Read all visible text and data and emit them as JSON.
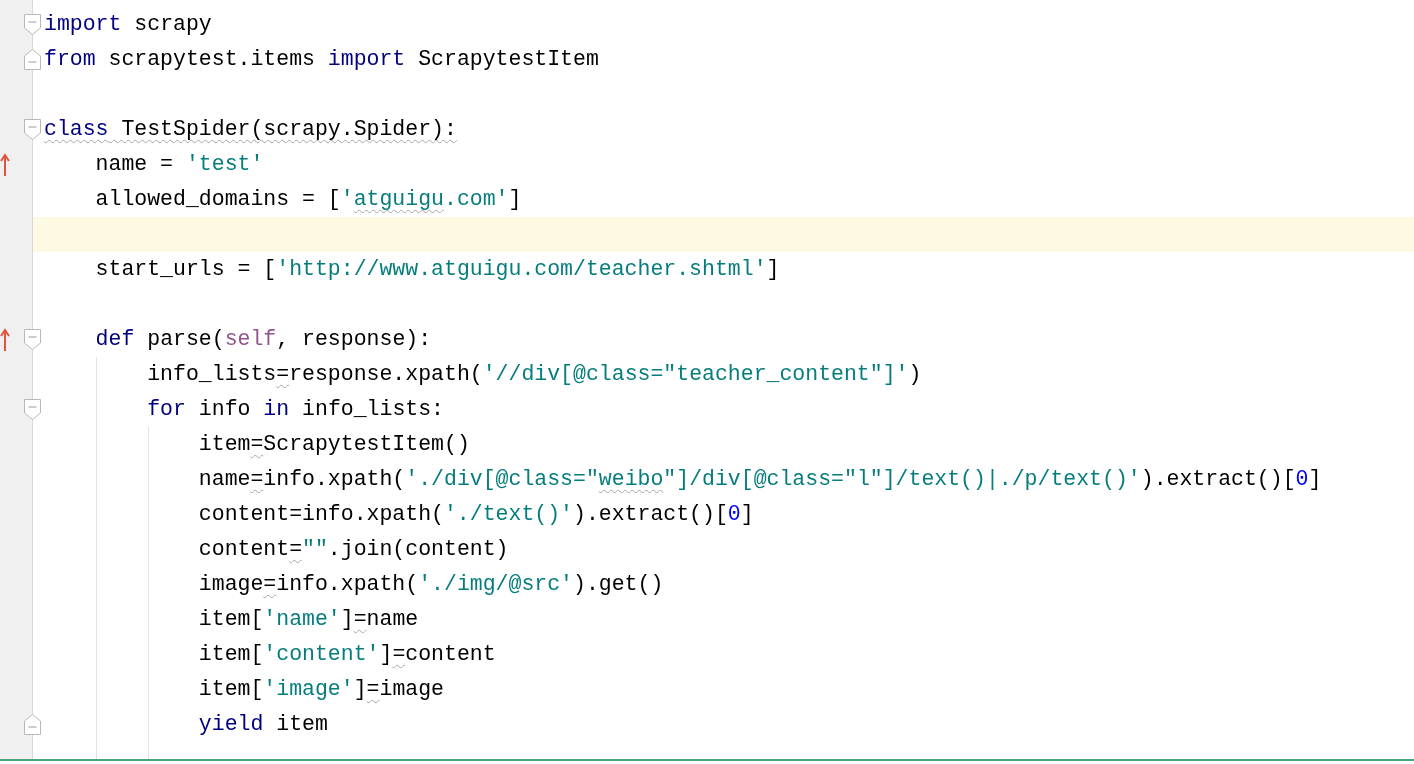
{
  "editor": {
    "lines": [
      {
        "current": false,
        "gutter": [
          {
            "kind": "fold-start"
          }
        ],
        "tokens": [
          {
            "t": "import",
            "kind": "keyword"
          },
          {
            "t": " scrapy",
            "kind": "plain"
          }
        ]
      },
      {
        "current": false,
        "gutter": [
          {
            "kind": "fold-end"
          }
        ],
        "tokens": [
          {
            "t": "from",
            "kind": "keyword"
          },
          {
            "t": " scrapytest.items ",
            "kind": "plain"
          },
          {
            "t": "import",
            "kind": "keyword"
          },
          {
            "t": " ScrapytestItem",
            "kind": "plain"
          }
        ]
      },
      {
        "current": false
      },
      {
        "current": false,
        "gutter": [
          {
            "kind": "fold-start"
          }
        ],
        "tokens": [
          {
            "t": "class",
            "kind": "keyword",
            "warn": true
          },
          {
            "t": " TestSpider(scrapy.Spider):",
            "kind": "plain",
            "warn": true
          }
        ]
      },
      {
        "current": false,
        "gutter": [
          {
            "kind": "override"
          }
        ],
        "tokens": [
          {
            "t": "    name = ",
            "kind": "plain"
          },
          {
            "t": "'test'",
            "kind": "string"
          }
        ]
      },
      {
        "current": false,
        "tokens": [
          {
            "t": "    allowed_domains = [",
            "kind": "plain"
          },
          {
            "t": "'",
            "kind": "string"
          },
          {
            "t": "atguigu",
            "kind": "string",
            "warn": true
          },
          {
            "t": ".com'",
            "kind": "string"
          },
          {
            "t": "]",
            "kind": "plain"
          }
        ]
      },
      {
        "current": true
      },
      {
        "current": false,
        "tokens": [
          {
            "t": "    start_urls = [",
            "kind": "plain"
          },
          {
            "t": "'http://www.atguigu.com/teacher.shtml'",
            "kind": "string"
          },
          {
            "t": "]",
            "kind": "plain"
          }
        ]
      },
      {
        "current": false
      },
      {
        "current": false,
        "gutter": [
          {
            "kind": "override"
          },
          {
            "kind": "fold-start"
          }
        ],
        "tokens": [
          {
            "t": "    def",
            "kind": "keyword"
          },
          {
            "t": " parse(",
            "kind": "plain"
          },
          {
            "t": "self",
            "kind": "self"
          },
          {
            "t": ", response):",
            "kind": "plain"
          }
        ]
      },
      {
        "current": false,
        "tokens": [
          {
            "t": "        info_lists",
            "kind": "plain"
          },
          {
            "t": "=",
            "kind": "plain",
            "warn": true
          },
          {
            "t": "response.xpath(",
            "kind": "plain"
          },
          {
            "t": "'//div[@class=\"teacher_content\"]'",
            "kind": "string"
          },
          {
            "t": ")",
            "kind": "plain"
          }
        ]
      },
      {
        "current": false,
        "gutter": [
          {
            "kind": "fold-start"
          }
        ],
        "tokens": [
          {
            "t": "        for",
            "kind": "keyword"
          },
          {
            "t": " info ",
            "kind": "plain"
          },
          {
            "t": "in",
            "kind": "keyword"
          },
          {
            "t": " info_lists:",
            "kind": "plain"
          }
        ]
      },
      {
        "current": false,
        "tokens": [
          {
            "t": "            item",
            "kind": "plain"
          },
          {
            "t": "=",
            "kind": "plain",
            "warn": true
          },
          {
            "t": "ScrapytestItem()",
            "kind": "plain"
          }
        ]
      },
      {
        "current": false,
        "tokens": [
          {
            "t": "            name",
            "kind": "plain"
          },
          {
            "t": "=",
            "kind": "plain",
            "warn": true
          },
          {
            "t": "info.xpath(",
            "kind": "plain"
          },
          {
            "t": "'./div[@class=\"",
            "kind": "string"
          },
          {
            "t": "weibo",
            "kind": "string",
            "warn": true
          },
          {
            "t": "\"]/div[@class=\"l\"]/text()|./p/text()'",
            "kind": "string"
          },
          {
            "t": ").extract()[",
            "kind": "plain"
          },
          {
            "t": "0",
            "kind": "number"
          },
          {
            "t": "]",
            "kind": "plain"
          }
        ]
      },
      {
        "current": false,
        "tokens": [
          {
            "t": "            content=info.xpath(",
            "kind": "plain"
          },
          {
            "t": "'./text()'",
            "kind": "string"
          },
          {
            "t": ").extract()[",
            "kind": "plain"
          },
          {
            "t": "0",
            "kind": "number"
          },
          {
            "t": "]",
            "kind": "plain"
          }
        ]
      },
      {
        "current": false,
        "tokens": [
          {
            "t": "            content",
            "kind": "plain"
          },
          {
            "t": "=",
            "kind": "plain",
            "warn": true
          },
          {
            "t": "\"\"",
            "kind": "string"
          },
          {
            "t": ".join(content)",
            "kind": "plain"
          }
        ]
      },
      {
        "current": false,
        "tokens": [
          {
            "t": "            image",
            "kind": "plain"
          },
          {
            "t": "=",
            "kind": "plain",
            "warn": true
          },
          {
            "t": "info.xpath(",
            "kind": "plain"
          },
          {
            "t": "'./img/@src'",
            "kind": "string"
          },
          {
            "t": ").get()",
            "kind": "plain"
          }
        ]
      },
      {
        "current": false,
        "tokens": [
          {
            "t": "            item[",
            "kind": "plain"
          },
          {
            "t": "'name'",
            "kind": "string"
          },
          {
            "t": "]",
            "kind": "plain"
          },
          {
            "t": "=",
            "kind": "plain",
            "warn": true
          },
          {
            "t": "name",
            "kind": "plain"
          }
        ]
      },
      {
        "current": false,
        "tokens": [
          {
            "t": "            item[",
            "kind": "plain"
          },
          {
            "t": "'content'",
            "kind": "string"
          },
          {
            "t": "]",
            "kind": "plain"
          },
          {
            "t": "=",
            "kind": "plain",
            "warn": true
          },
          {
            "t": "content",
            "kind": "plain"
          }
        ]
      },
      {
        "current": false,
        "tokens": [
          {
            "t": "            item[",
            "kind": "plain"
          },
          {
            "t": "'image'",
            "kind": "string"
          },
          {
            "t": "]",
            "kind": "plain"
          },
          {
            "t": "=",
            "kind": "plain",
            "warn": true
          },
          {
            "t": "image",
            "kind": "plain"
          }
        ]
      },
      {
        "current": false,
        "gutter": [
          {
            "kind": "fold-end"
          }
        ],
        "tokens": [
          {
            "t": "            yield",
            "kind": "keyword"
          },
          {
            "t": " item",
            "kind": "plain"
          }
        ]
      },
      {
        "current": false
      }
    ]
  }
}
